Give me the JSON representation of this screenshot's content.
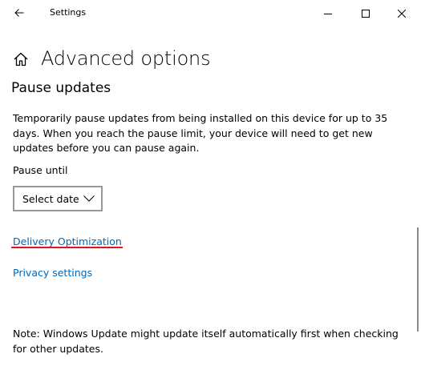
{
  "window": {
    "title": "Settings",
    "icons": {
      "back": "back-arrow-icon",
      "minimize": "minimize-icon",
      "maximize": "maximize-icon",
      "close": "close-icon"
    }
  },
  "header": {
    "icon": "home-icon",
    "title": "Advanced options"
  },
  "pause_updates": {
    "section_title": "Pause updates",
    "description": "Temporarily pause updates from being installed on this device for up to 35 days. When you reach the pause limit, your device will need to get new updates before you can pause again.",
    "pause_until_label": "Pause until",
    "select": {
      "value": "Select date",
      "icon": "chevron-down-icon"
    }
  },
  "links": {
    "delivery_optimization": "Delivery Optimization",
    "privacy_settings": "Privacy settings"
  },
  "note": "Note: Windows Update might update itself automatically first when checking for other updates.",
  "colors": {
    "link": "#0067b8",
    "highlight_underline": "#e81123",
    "select_border": "#999999"
  }
}
